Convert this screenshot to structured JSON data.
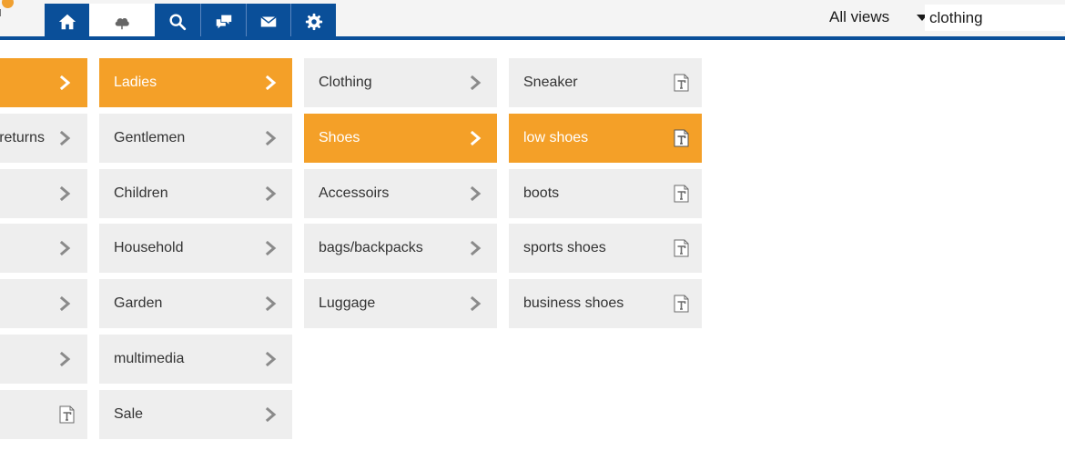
{
  "toolbar": {
    "tabs": [
      {
        "name": "home-icon"
      },
      {
        "name": "cloud-icon"
      },
      {
        "name": "search-icon"
      },
      {
        "name": "chat-icon"
      },
      {
        "name": "mail-icon"
      },
      {
        "name": "gear-icon"
      }
    ],
    "views_label": "All views",
    "search_value": "clothing",
    "active_tab_color": "#ffffff",
    "tab_color": "#0a4f99"
  },
  "accent_color": "#f4a028",
  "columns": [
    {
      "items": [
        {
          "label": "",
          "selected": true,
          "icon": "chevron-right-icon"
        },
        {
          "label": "returns",
          "selected": false,
          "icon": "chevron-right-icon"
        },
        {
          "label": "",
          "selected": false,
          "icon": "chevron-right-icon"
        },
        {
          "label": "",
          "selected": false,
          "icon": "chevron-right-icon"
        },
        {
          "label": "",
          "selected": false,
          "icon": "chevron-right-icon"
        },
        {
          "label": "",
          "selected": false,
          "icon": "chevron-right-icon"
        },
        {
          "label": "",
          "selected": false,
          "icon": "text-document-icon"
        }
      ]
    },
    {
      "items": [
        {
          "label": "Ladies",
          "selected": true,
          "icon": "chevron-right-icon"
        },
        {
          "label": "Gentlemen",
          "selected": false,
          "icon": "chevron-right-icon"
        },
        {
          "label": "Children",
          "selected": false,
          "icon": "chevron-right-icon"
        },
        {
          "label": "Household",
          "selected": false,
          "icon": "chevron-right-icon"
        },
        {
          "label": "Garden",
          "selected": false,
          "icon": "chevron-right-icon"
        },
        {
          "label": "multimedia",
          "selected": false,
          "icon": "chevron-right-icon"
        },
        {
          "label": "Sale",
          "selected": false,
          "icon": "chevron-right-icon"
        }
      ]
    },
    {
      "items": [
        {
          "label": "Clothing",
          "selected": false,
          "icon": "chevron-right-icon"
        },
        {
          "label": "Shoes",
          "selected": true,
          "icon": "chevron-right-icon"
        },
        {
          "label": "Accessoirs",
          "selected": false,
          "icon": "chevron-right-icon"
        },
        {
          "label": "bags/backpacks",
          "selected": false,
          "icon": "chevron-right-icon"
        },
        {
          "label": "Luggage",
          "selected": false,
          "icon": "chevron-right-icon"
        }
      ]
    },
    {
      "items": [
        {
          "label": "Sneaker",
          "selected": false,
          "icon": "text-document-icon"
        },
        {
          "label": "low shoes",
          "selected": true,
          "icon": "text-document-icon"
        },
        {
          "label": "boots",
          "selected": false,
          "icon": "text-document-icon"
        },
        {
          "label": "sports shoes",
          "selected": false,
          "icon": "text-document-icon"
        },
        {
          "label": "business shoes",
          "selected": false,
          "icon": "text-document-icon"
        }
      ]
    }
  ]
}
